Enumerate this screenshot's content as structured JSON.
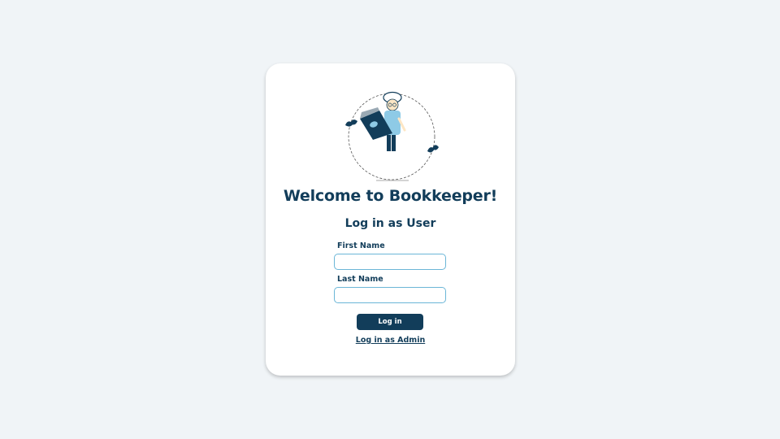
{
  "card": {
    "title": "Welcome to Bookkeeper!",
    "subtitle": "Log in as User"
  },
  "form": {
    "first_name_label": "First Name",
    "first_name_value": "",
    "last_name_label": "Last Name",
    "last_name_value": "",
    "submit_label": "Log in"
  },
  "admin_link": "Log in as Admin",
  "illustration": "person-reading-book-icon",
  "colors": {
    "background": "#f0f4f7",
    "primary": "#123d5a",
    "input_border": "#6bb6d7",
    "accent_light": "#8ecae6"
  }
}
